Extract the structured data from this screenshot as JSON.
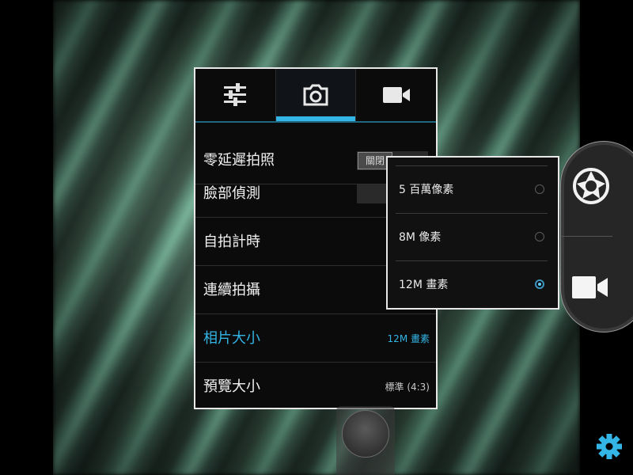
{
  "colors": {
    "accent": "#33b5e5",
    "panel_background": "#0b0b0b",
    "panel_border": "#e8e8e8",
    "text_primary": "#f2f2f2"
  },
  "settings_panel": {
    "tabs": [
      {
        "icon": "sliders-icon",
        "active": false
      },
      {
        "icon": "camera-icon",
        "active": true
      },
      {
        "icon": "video-camera-icon",
        "active": false
      }
    ],
    "rows": [
      {
        "label": "零延遲拍照",
        "control": "toggle",
        "value": "關閉"
      },
      {
        "label": "臉部偵測",
        "control": "toggle",
        "value": ""
      },
      {
        "label": "自拍計時",
        "value": ""
      },
      {
        "label": "連續拍攝",
        "value": ""
      },
      {
        "label": "相片大小",
        "value": "12M 畫素",
        "highlighted": true
      },
      {
        "label": "預覽大小",
        "value": "標準 (4:3)"
      }
    ]
  },
  "photo_size_popup": {
    "options": [
      {
        "label": "5 百萬像素",
        "selected": false
      },
      {
        "label": "8M 像素",
        "selected": false
      },
      {
        "label": "12M 畫素",
        "selected": true
      }
    ]
  },
  "mode_switcher": {
    "items": [
      {
        "icon": "shutter-aperture-icon"
      },
      {
        "icon": "video-camera-icon"
      }
    ]
  },
  "shutter_button": {
    "icon": "shutter-button"
  },
  "settings_button": {
    "icon": "gear-icon"
  }
}
